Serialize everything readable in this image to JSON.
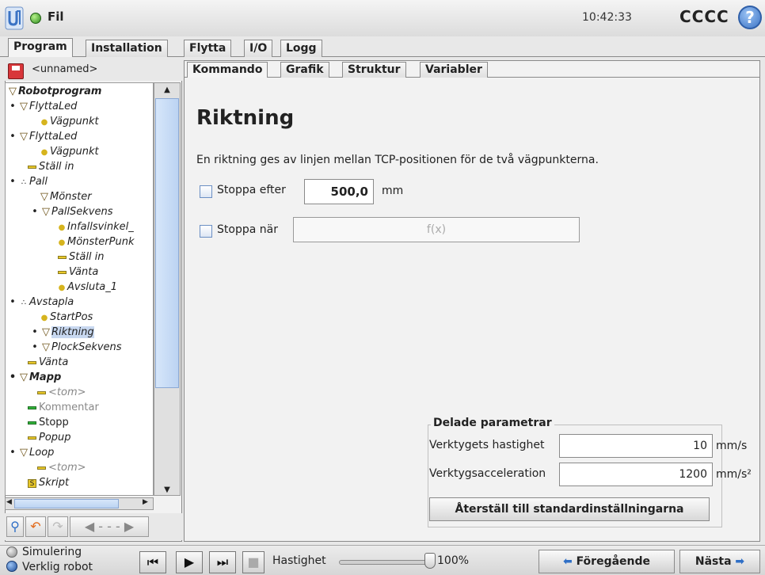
{
  "header": {
    "file_menu": "Fil",
    "clock": "10:42:33",
    "robot_name": "CCCC",
    "help_glyph": "?"
  },
  "main_tabs": [
    {
      "label": "Program"
    },
    {
      "label": "Installation"
    },
    {
      "label": "Flytta"
    },
    {
      "label": "I/O"
    },
    {
      "label": "Logg"
    }
  ],
  "left": {
    "filename": "<unnamed>",
    "tree": [
      {
        "label": "Robotprogram"
      },
      {
        "label": "FlyttaLed"
      },
      {
        "label": "Vägpunkt"
      },
      {
        "label": "FlyttaLed"
      },
      {
        "label": "Vägpunkt"
      },
      {
        "label": "Ställ in"
      },
      {
        "label": "Pall"
      },
      {
        "label": "Mönster"
      },
      {
        "label": "PallSekvens"
      },
      {
        "label": "Infallsvinkel_"
      },
      {
        "label": "MönsterPunk"
      },
      {
        "label": "Ställ in"
      },
      {
        "label": "Vänta"
      },
      {
        "label": "Avsluta_1"
      },
      {
        "label": "Avstapla"
      },
      {
        "label": "StartPos"
      },
      {
        "label": "Riktning"
      },
      {
        "label": "PlockSekvens"
      },
      {
        "label": "Vänta"
      },
      {
        "label": "Mapp"
      },
      {
        "label": "<tom>"
      },
      {
        "label": "Kommentar"
      },
      {
        "label": "Stopp"
      },
      {
        "label": "Popup"
      },
      {
        "label": "Loop"
      },
      {
        "label": "<tom>"
      },
      {
        "label": "Skript"
      }
    ]
  },
  "sub_tabs": [
    {
      "label": "Kommando"
    },
    {
      "label": "Grafik"
    },
    {
      "label": "Struktur"
    },
    {
      "label": "Variabler"
    }
  ],
  "main": {
    "heading": "Riktning",
    "description": "En riktning ges av linjen mellan TCP-positionen för de två vägpunkterna.",
    "stop_after": {
      "label": "Stoppa efter",
      "value": "500,0",
      "unit": "mm",
      "checked": false
    },
    "stop_when": {
      "label": "Stoppa när",
      "expression_placeholder": "f(x)",
      "checked": false
    },
    "shared": {
      "title": "Delade parametrar",
      "tool_speed": {
        "label": "Verktygets hastighet",
        "value": "10",
        "unit": "mm/s"
      },
      "tool_accel": {
        "label": "Verktygsacceleration",
        "value": "1200",
        "unit": "mm/s²"
      },
      "reset_label": "Återställ till standardinställningarna"
    }
  },
  "footer": {
    "simulation_label": "Simulering",
    "real_robot_label": "Verklig robot",
    "speed_label": "Hastighet",
    "speed_value": "100%",
    "speed_fraction": 1.0,
    "prev_label": "Föregående",
    "next_label": "Nästa"
  },
  "colors": {
    "accent": "#3b73c4",
    "selection": "#c8d8f0",
    "tree_bar_yellow": "#e9c829",
    "tree_bar_green": "#31b33a"
  }
}
